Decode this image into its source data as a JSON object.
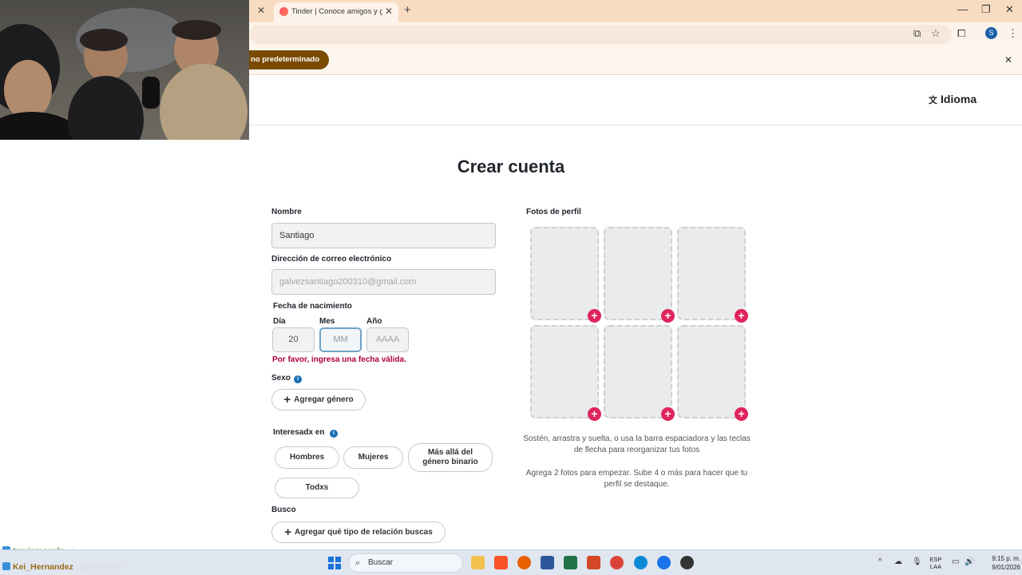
{
  "browser": {
    "tab_title": "Tinder | Conoce amigos y gente nueva",
    "prev_tab_close": "✕",
    "tab_close": "✕",
    "new_tab": "+",
    "minimize": "—",
    "restore": "❐",
    "close": "✕",
    "profile_initial": "S",
    "infobar_button": "no predeterminado",
    "infobar_close": "✕"
  },
  "header": {
    "language_label": "Idioma"
  },
  "form": {
    "title": "Crear cuenta",
    "name_label": "Nombre",
    "name_value": "Santiago",
    "email_label": "Dirección de correo electrónico",
    "email_value": "galvezsantiago200310@gmail.com",
    "birthdate_label": "Fecha de nacimiento",
    "day_label": "Día",
    "month_label": "Mes",
    "year_label": "Año",
    "day_value": "20",
    "month_placeholder": "MM",
    "year_placeholder": "AAAA",
    "date_error": "Por favor, ingresa una fecha válida.",
    "sex_label": "Sexo",
    "add_gender": "Agregar género",
    "interested_label": "Interesadx en",
    "interest_options": [
      "Hombres",
      "Mujeres",
      "Más allá del género binario",
      "Todxs"
    ],
    "looking_for_label": "Busco",
    "add_relationship": "Agregar qué tipo de relación buscas"
  },
  "photos": {
    "label": "Fotos de perfil",
    "hint1": "Sostén, arrastra y suelta, o usa la barra espaciadora y las teclas de flecha para reorganizar tus fotos",
    "hint2": "Agrega 2 fotos para empezar. Sube 4 o más para hacer que tu perfil se destaque."
  },
  "chat": [
    {
      "user": "travismaculn",
      "message": "la mudaaa"
    },
    {
      "user": "Kei_Hernandez",
      "message": "qué comen"
    }
  ],
  "taskbar": {
    "search_placeholder": "Buscar",
    "lang_top": "ESP",
    "lang_bottom": "LAA",
    "time": "9:15 p. m.",
    "date": "9/01/2026"
  },
  "colors": {
    "accent": "#e0245e",
    "error": "#b0003a",
    "info_button": "#7a4a00"
  }
}
